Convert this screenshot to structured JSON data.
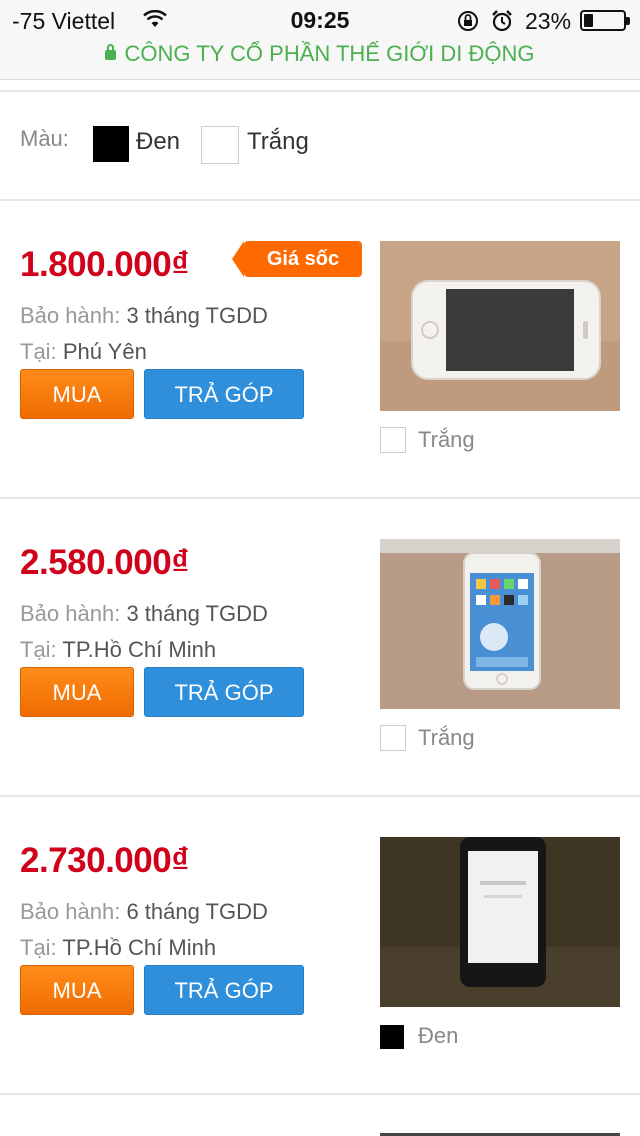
{
  "status_bar": {
    "carrier": "-75 Viettel",
    "time": "09:25",
    "battery": "23%",
    "url_text": "CÔNG TY CỔ PHẦN THẾ GIỚI DI ĐỘNG",
    "icons": [
      "wifi-icon",
      "orientation-lock-icon",
      "alarm-icon",
      "battery-icon",
      "lock-icon"
    ]
  },
  "color_filter": {
    "label": "Màu:",
    "options": [
      {
        "name": "Đen",
        "color": "#000000"
      },
      {
        "name": "Trắng",
        "color": "#ffffff"
      }
    ]
  },
  "buttons": {
    "buy": "MUA",
    "installment": "TRẢ GÓP"
  },
  "colors": {
    "price": "#d0021b",
    "buy": "#ef6c00",
    "installment": "#2f8fdb",
    "badge": "#ff6a00",
    "secure": "#4caf50"
  },
  "products": [
    {
      "price": "1.800.000₫",
      "badge": "Giá sốc",
      "warranty_label": "Bảo hành:",
      "warranty_value": "3 tháng TGDD",
      "location_label": "Tại:",
      "location_value": "Phú Yên",
      "color_name": "Trắng",
      "color_hex": "#ffffff"
    },
    {
      "price": "2.580.000₫",
      "warranty_label": "Bảo hành:",
      "warranty_value": "3 tháng TGDD",
      "location_label": "Tại:",
      "location_value": "TP.Hồ Chí Minh",
      "color_name": "Trắng",
      "color_hex": "#ffffff"
    },
    {
      "price": "2.730.000₫",
      "warranty_label": "Bảo hành:",
      "warranty_value": "6 tháng TGDD",
      "location_label": "Tại:",
      "location_value": "TP.Hồ Chí Minh",
      "color_name": "Đen",
      "color_hex": "#000000"
    }
  ]
}
